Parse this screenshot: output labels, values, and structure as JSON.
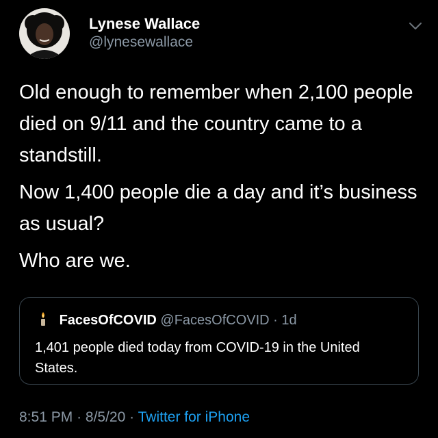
{
  "author": {
    "display_name": "Lynese Wallace",
    "handle": "@lynesewallace"
  },
  "tweet": {
    "paragraphs": [
      "Old enough to remember when 2,100 people died on 9/11 and the country came to a standstill.",
      "Now 1,400 people die a day and it’s business as usual?",
      "Who are we."
    ]
  },
  "quoted_tweet": {
    "icon": "candle-icon",
    "display_name": "FacesOfCOVID",
    "handle": "@FacesOfCOVID",
    "separator": "·",
    "time": "1d",
    "text": "1,401 people died today from COVID-19 in the United States."
  },
  "footer": {
    "time": "8:51 PM",
    "sep1": "·",
    "date": "8/5/20",
    "sep2": "·",
    "source": "Twitter for iPhone"
  },
  "colors": {
    "background": "#000000",
    "text": "#ffffff",
    "secondary": "#8b98a5",
    "link": "#1da1f2",
    "border": "#38444d"
  }
}
